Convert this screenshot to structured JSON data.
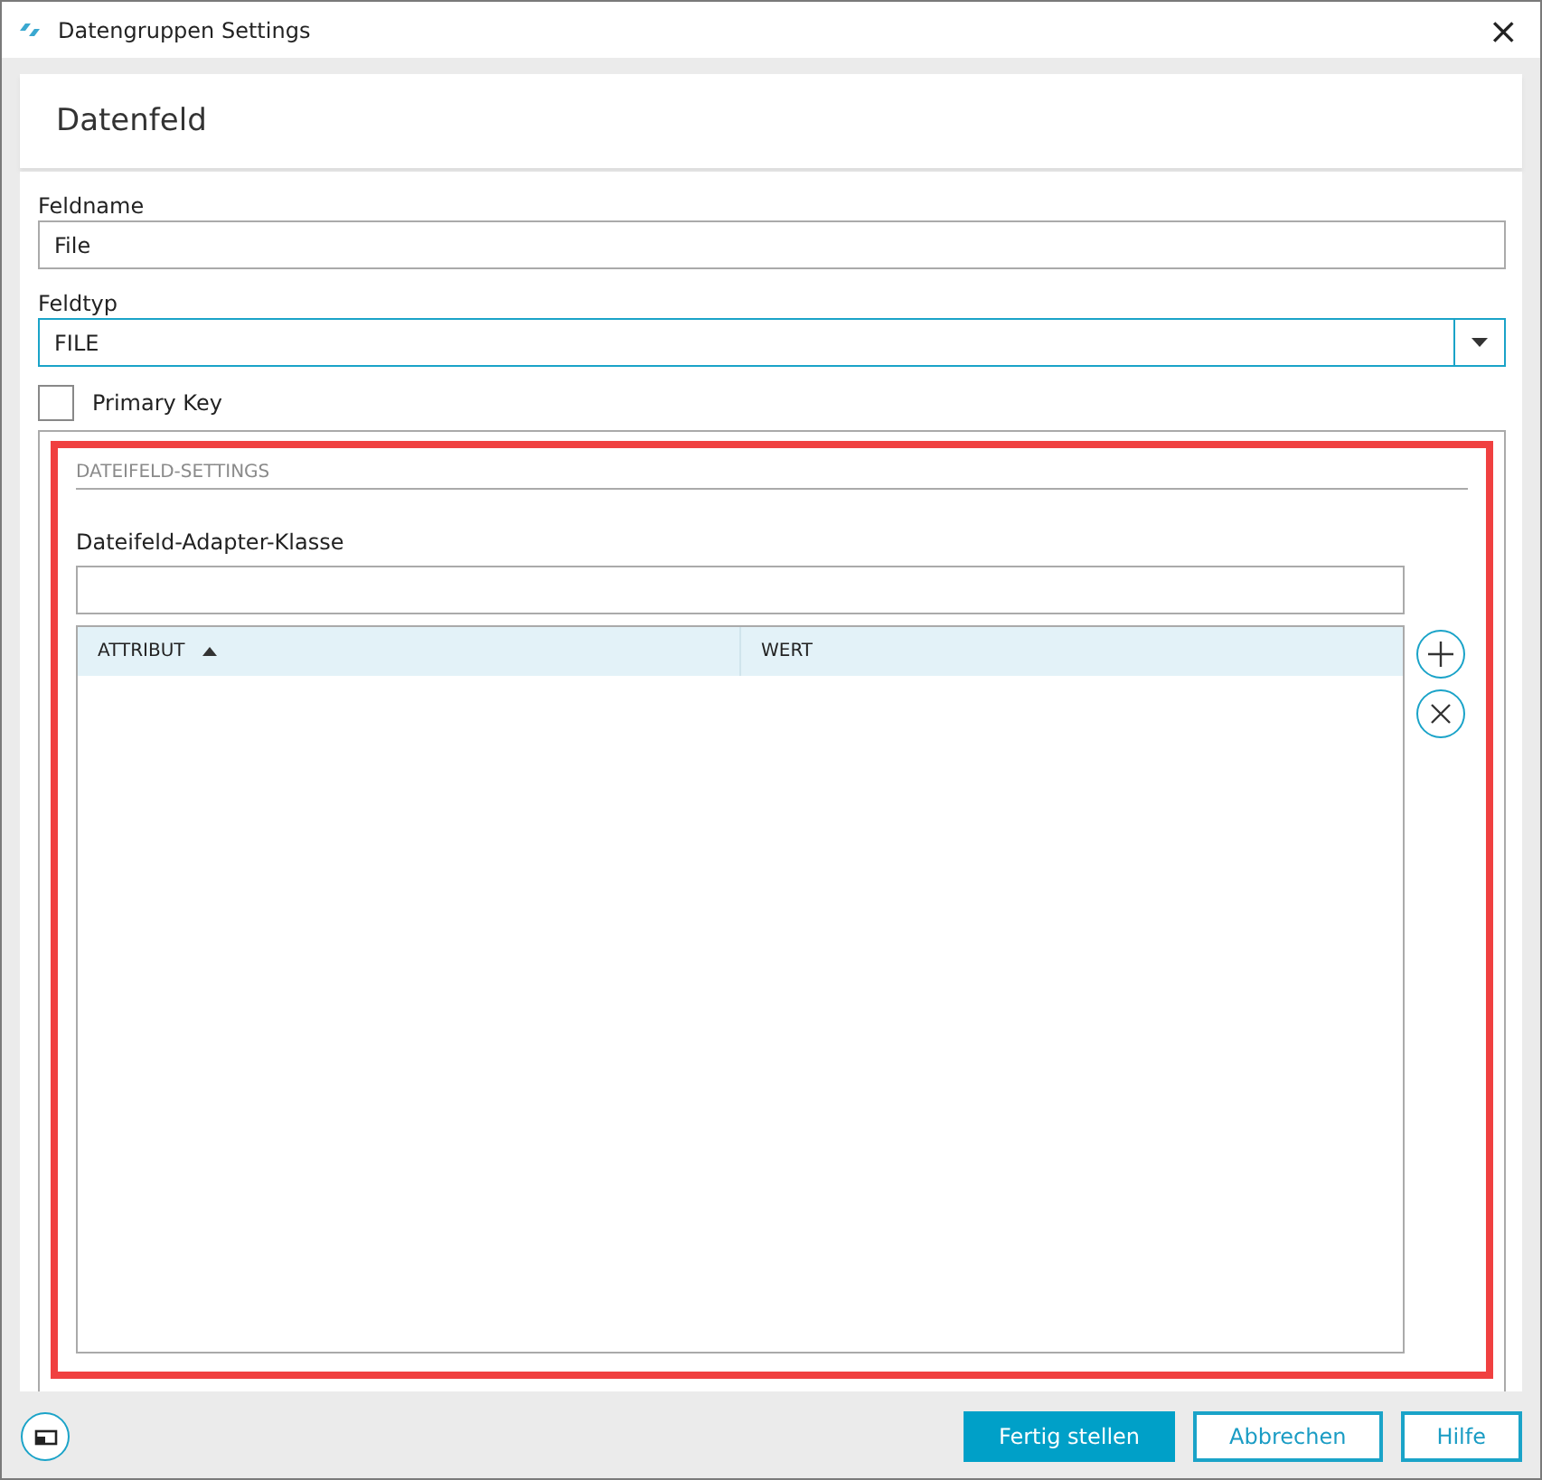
{
  "window": {
    "title": "Datengruppen Settings",
    "close": "×"
  },
  "header": {
    "title": "Datenfeld"
  },
  "fields": [
    {
      "kind": "text",
      "label": "Feldname",
      "value": "File"
    },
    {
      "kind": "select",
      "label": "Feldtyp",
      "value": "FILE"
    }
  ],
  "primary_key": {
    "label": "Primary Key",
    "checked": false
  },
  "section": {
    "title": "DATEIFELD-SETTINGS",
    "adapter_label": "Dateifeld-Adapter-Klasse",
    "table": {
      "columns": [
        {
          "label": "ATTRIBUT",
          "sorted": true
        },
        {
          "label": "WERT",
          "sorted": false
        }
      ]
    }
  },
  "buttons": [
    {
      "label": "Fertig stellen",
      "kind": "primary"
    },
    {
      "label": "Abbrechen",
      "kind": "secondary"
    },
    {
      "label": "Hilfe",
      "kind": "secondary"
    }
  ]
}
